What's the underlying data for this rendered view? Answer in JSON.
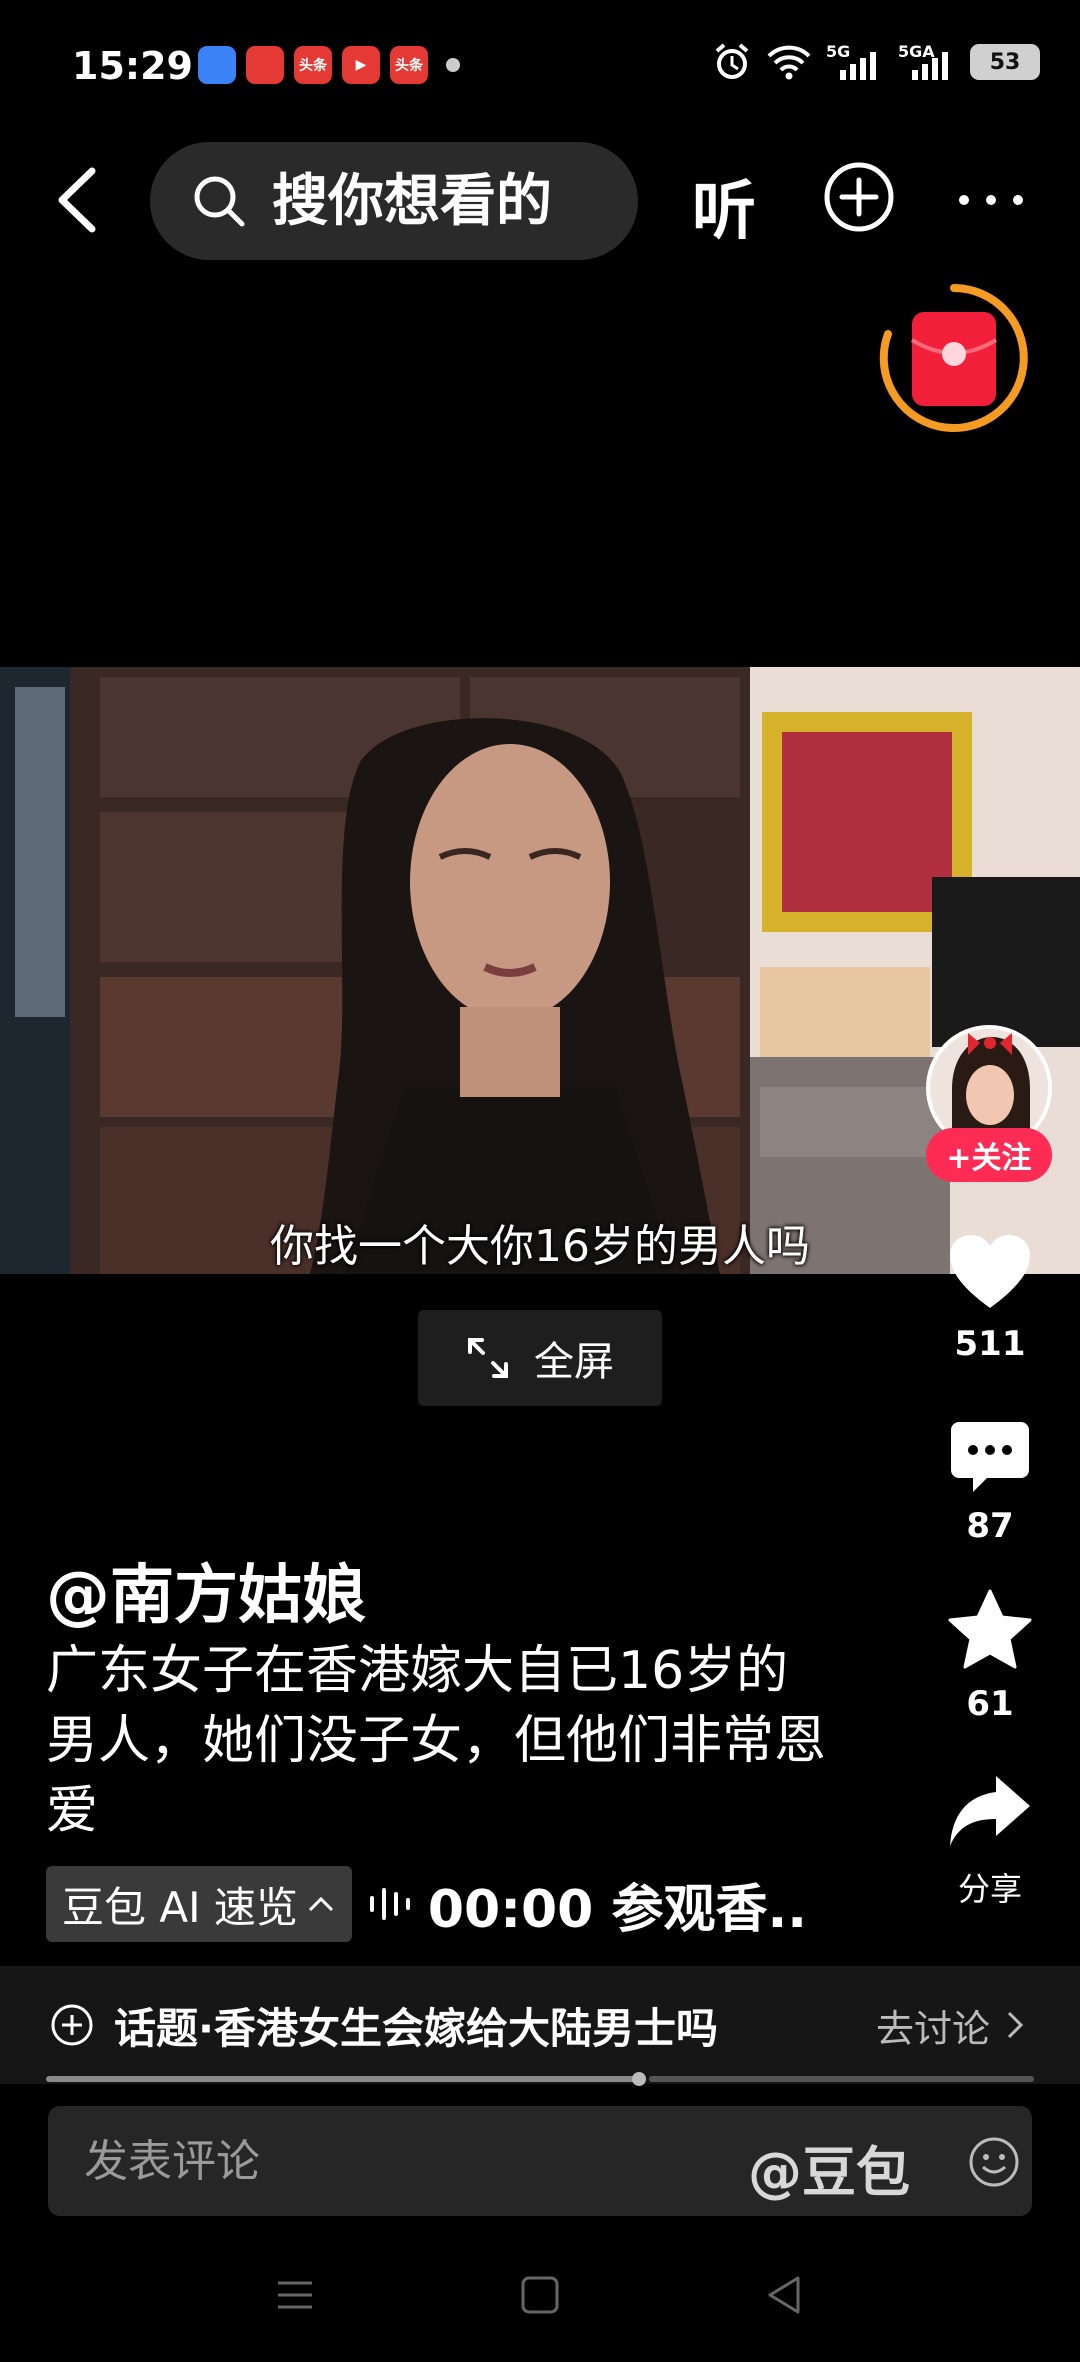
{
  "status_bar": {
    "time": "15:29",
    "apps": [
      {
        "icon": "blue-app-icon",
        "label": "",
        "color": "#3b82f6"
      },
      {
        "icon": "red-game-icon",
        "label": "",
        "color": "#e53935"
      },
      {
        "icon": "toutiao-icon",
        "label": "头条",
        "color": "#e53935"
      },
      {
        "icon": "video-play-icon",
        "label": "▶",
        "color": "#e53935"
      },
      {
        "icon": "toutiao-icon",
        "label": "头条",
        "color": "#e53935"
      }
    ],
    "signal_1": "5G",
    "signal_2": "5GA",
    "battery": "53"
  },
  "nav": {
    "search_placeholder": "搜你想看的",
    "listen_label": "听"
  },
  "video": {
    "subtitle": "你找一个大你16岁的男人吗",
    "fullscreen_label": "全屏"
  },
  "rail": {
    "follow_label": "+关注",
    "likes": "511",
    "comments": "87",
    "favorites": "61",
    "share_label": "分享"
  },
  "post": {
    "author": "@南方姑娘",
    "description": "广东女子在香港嫁大自已16岁的男人，她们没子女，但他们非常恩爱",
    "ai_badge_label": "豆包 AI 速览",
    "ai_preview": "00:00 参观香.."
  },
  "topic": {
    "text": "话题·香港女生会嫁给大陆男士吗",
    "link": "去讨论"
  },
  "progress": {
    "played_fraction": 0.6
  },
  "comment": {
    "placeholder": "发表评论",
    "at_label": "@豆包"
  },
  "colors": {
    "accent_red": "#fe2c55",
    "background": "#000000",
    "redpacket_ring": "#f59a23"
  }
}
